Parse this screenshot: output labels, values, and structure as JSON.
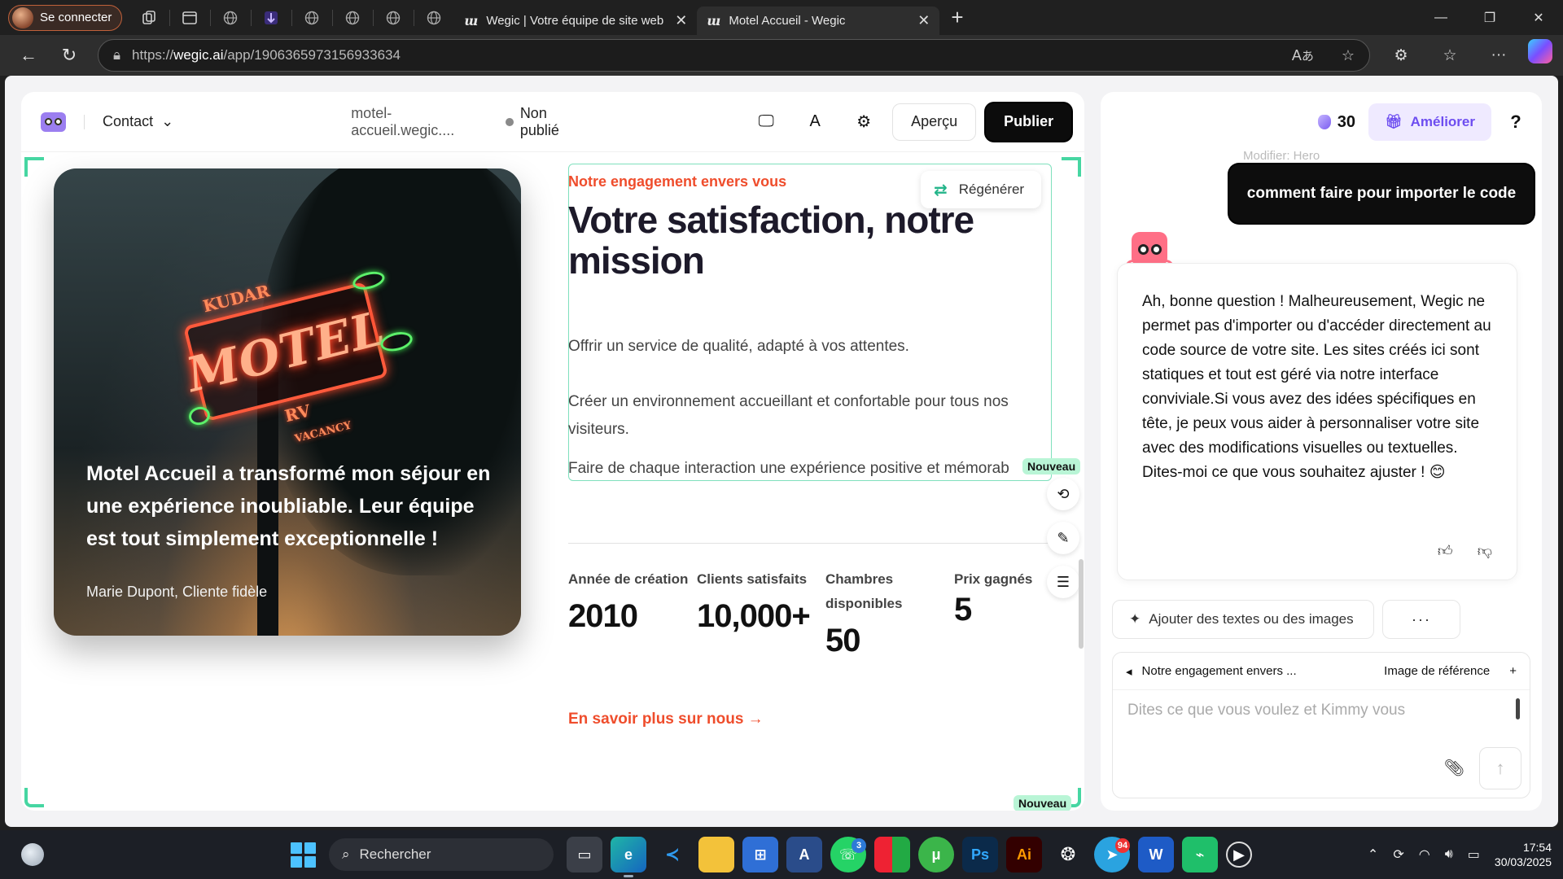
{
  "browser": {
    "profile_label": "Se connecter",
    "tabs": [
      {
        "title": "Wegic | Votre équipe de site web"
      },
      {
        "title": "Motel Accueil - Wegic"
      }
    ],
    "url_prefix": "https://",
    "url_host": "wegic.ai",
    "url_path": "/app/1906365973156933634"
  },
  "editor": {
    "page_select": "Contact",
    "domain": "motel-accueil.wegic....",
    "status": "Non publié",
    "preview_label": "Aperçu",
    "publish_label": "Publier",
    "regen_label": "Régénérer",
    "new_badge": "Nouveau",
    "testimonial": {
      "quote": "Motel Accueil a transformé mon séjour en une expérience inoubliable. Leur équipe est tout simplement exceptionnelle !",
      "author": "Marie Dupont, Cliente fidèle",
      "sign_text": "MOTEL",
      "sign_top": "KUDAR",
      "sign_mid": "RV",
      "sign_bottom": "VACANCY"
    },
    "eyebrow": "Notre engagement envers vous",
    "headline": "Votre satisfaction, notre mission",
    "paragraphs": [
      "Offrir un service de qualité, adapté à vos attentes.",
      "Créer un environnement accueillant et confortable pour tous nos visiteurs.",
      "Faire de chaque interaction une expérience positive et mémorab"
    ],
    "stats": [
      {
        "label": "Année de création",
        "value": "2010"
      },
      {
        "label": "Clients satisfaits",
        "value": "10,000+"
      },
      {
        "label": "Chambres disponibles",
        "value": "50"
      },
      {
        "label": "Prix gagnés",
        "value": "5"
      }
    ],
    "learn_more": "En savoir plus sur nous →"
  },
  "chat": {
    "credits": "30",
    "upgrade_label": "Améliorer",
    "help": "?",
    "ghost_text": "Modifier: Hero",
    "user_message": "comment faire pour importer le code",
    "bot_message": "Ah, bonne question ! Malheureusement, Wegic ne permet pas d'importer ou d'accéder directement au code source de votre site. Les sites créés ici sont statiques et tout est géré via notre interface conviviale.Si vous avez des idées spécifiques en tête, je peux vous aider à personnaliser votre site avec des modifications visuelles ou textuelles. Dites-moi ce que vous souhaitez ajuster ! 😊",
    "add_content_label": "Ajouter des textes ou des images",
    "more_label": "···",
    "ref_section": "Notre engagement envers ...",
    "ref_image_label": "Image de référence",
    "input_placeholder": "Dites ce que vous voulez et Kimmy vous"
  },
  "taskbar": {
    "search_label": "Rechercher",
    "whatsapp_badge": "3",
    "telegram_badge": "94",
    "time": "17:54",
    "date": "30/03/2025"
  }
}
